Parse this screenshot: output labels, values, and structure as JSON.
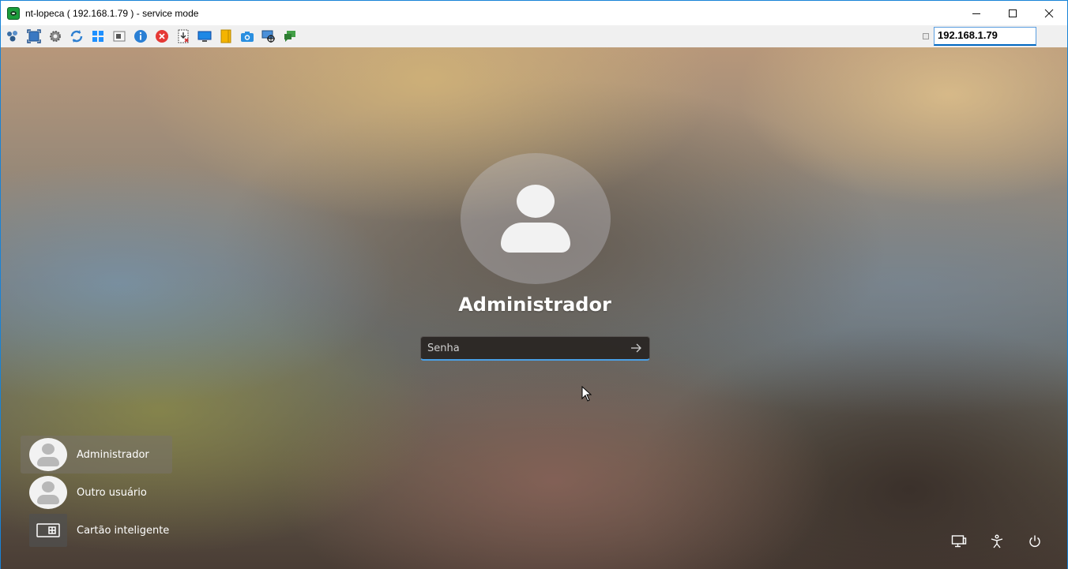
{
  "window": {
    "title": "nt-lopeca ( 192.168.1.79 ) - service mode",
    "controls": {
      "minimize_icon": "minimize-icon",
      "maximize_icon": "maximize-icon",
      "close_icon": "close-icon"
    }
  },
  "toolbar": {
    "icons": [
      "network-icon",
      "fullscreen-icon",
      "settings-gear-icon",
      "refresh-icon",
      "windows-start-icon",
      "ctrl-alt-del-icon",
      "info-icon",
      "disconnect-icon",
      "file-transfer-icon",
      "monitor-icon",
      "notes-icon",
      "screenshot-camera-icon",
      "remote-control-icon",
      "chat-icon"
    ],
    "host_value": "192.168.1.79"
  },
  "login": {
    "user_name": "Administrador",
    "password_placeholder": "Senha",
    "submit_icon": "arrow-right-icon"
  },
  "user_list": [
    {
      "label": "Administrador",
      "selected": true,
      "icon": "user-avatar-icon"
    },
    {
      "label": "Outro usuário",
      "selected": false,
      "icon": "user-avatar-icon"
    },
    {
      "label": "Cartão inteligente",
      "selected": false,
      "icon": "smart-card-icon"
    }
  ],
  "bottom_right": {
    "icons": [
      "network-status-icon",
      "accessibility-icon",
      "power-icon"
    ]
  },
  "colors": {
    "title_bar_border": "#1883d7",
    "input_focus": "#4aa0e6",
    "toolbar_bg": "#f0f0f0"
  }
}
